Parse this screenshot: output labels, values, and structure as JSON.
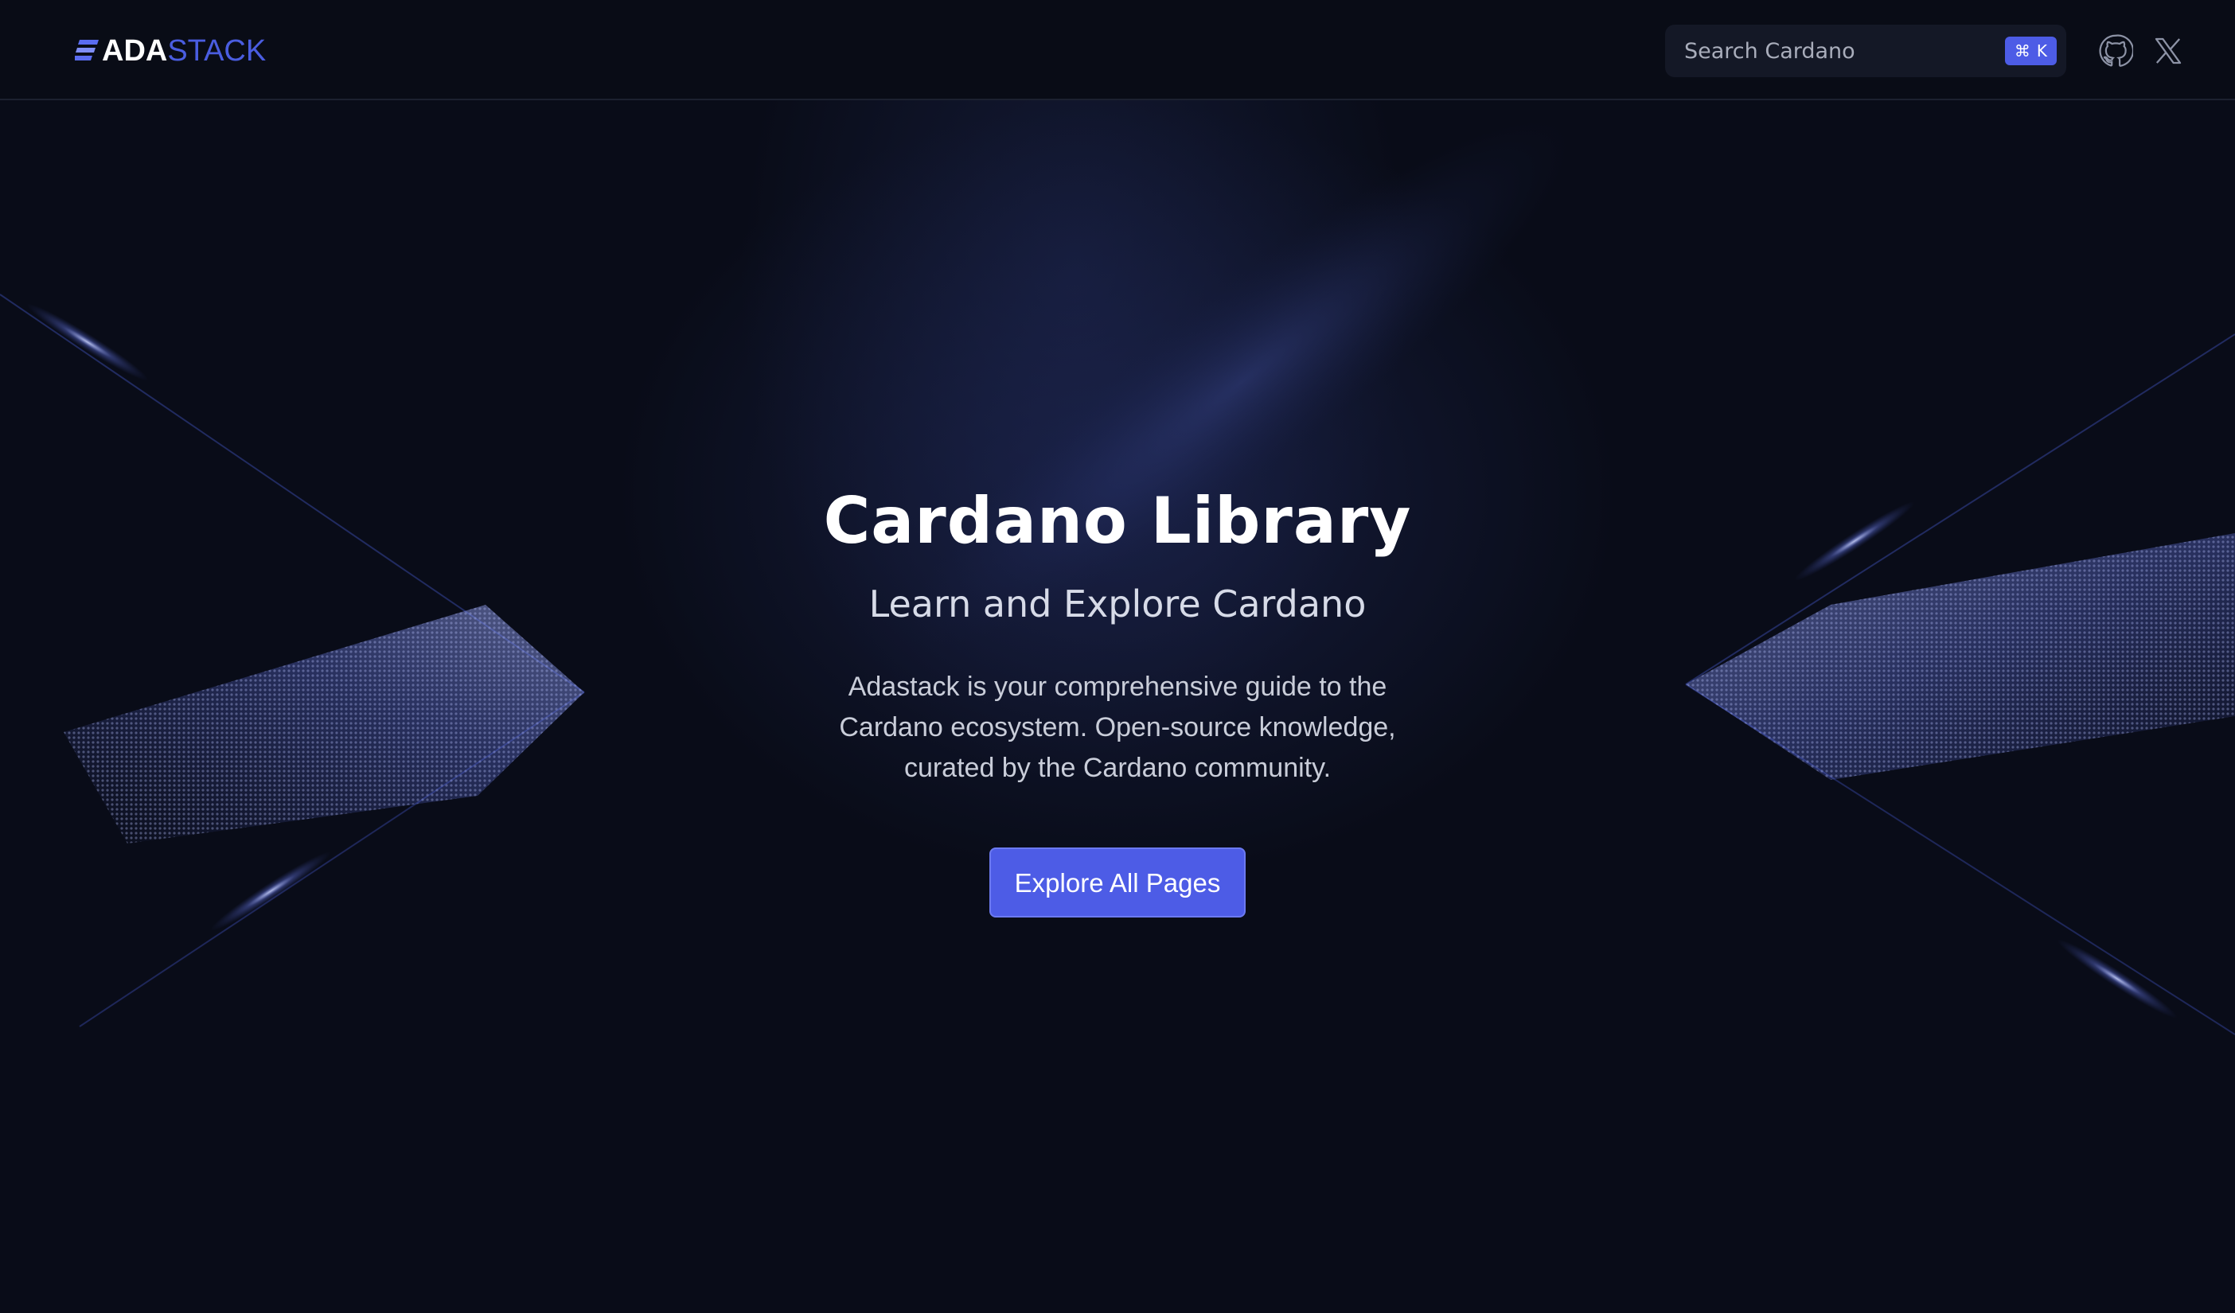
{
  "header": {
    "logo": {
      "part1": "ADA",
      "part2": "STACK"
    },
    "search": {
      "placeholder": "Search Cardano",
      "shortcut_symbol": "⌘",
      "shortcut_key": "K"
    },
    "icons": [
      "github-icon",
      "x-icon"
    ]
  },
  "hero": {
    "title": "Cardano Library",
    "subtitle": "Learn and Explore Cardano",
    "description": "Adastack is your comprehensive guide to the Cardano ecosystem. Open-source knowledge, curated by the Cardano community.",
    "cta_label": "Explore All Pages"
  },
  "colors": {
    "background": "#090c18",
    "accent": "#4d5ce6",
    "text": "#ffffff",
    "muted": "#c9cdd9"
  }
}
